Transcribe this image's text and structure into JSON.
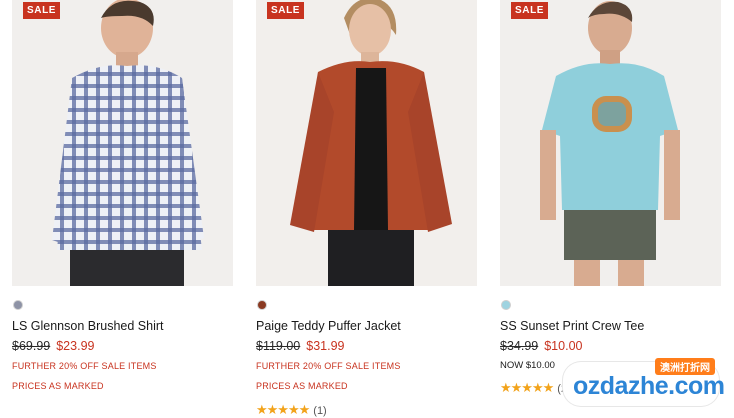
{
  "products": [
    {
      "badge": "SALE",
      "title": "LS Glennson Brushed Shirt",
      "was_price": "$69.99",
      "now_price": "$23.99",
      "promo_line1": "FURTHER 20% OFF SALE ITEMS",
      "promo_line2": "PRICES AS MARKED",
      "swatch_color": "#8e93a6",
      "image": "man-in-plaid-shirt-photo"
    },
    {
      "badge": "SALE",
      "title": "Paige Teddy Puffer Jacket",
      "was_price": "$119.00",
      "now_price": "$31.99",
      "promo_line1": "FURTHER 20% OFF SALE ITEMS",
      "promo_line2": "PRICES AS MARKED",
      "swatch_color": "#8a3a22",
      "rating_stars": 5,
      "rating_count": "(1)",
      "image": "woman-in-rust-jacket-photo"
    },
    {
      "badge": "SALE",
      "title": "SS Sunset Print Crew Tee",
      "was_price": "$34.99",
      "now_price": "$10.00",
      "now_note": "NOW $10.00",
      "swatch_color": "#9fd3e0",
      "rating_stars": 5,
      "rating_count": "(2",
      "image": "man-in-blue-tee-photo"
    }
  ],
  "watermark": {
    "text": "ozdazhe.com",
    "tag": "澳洲打折网"
  },
  "colors": {
    "sale_red": "#c8331f",
    "star": "#f2a31b"
  }
}
